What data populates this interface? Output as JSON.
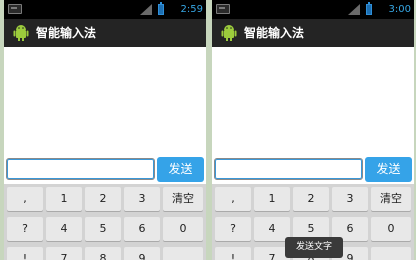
{
  "screens": [
    {
      "status_time": "2:59",
      "title": "智能输入法",
      "input_value": "",
      "send_label": "发送",
      "keys": [
        [
          ",",
          "1",
          "2",
          "3",
          "清空"
        ],
        [
          "?",
          "4",
          "5",
          "6",
          "0"
        ],
        [
          "!",
          "7",
          "8",
          "9",
          "."
        ]
      ],
      "toast": ""
    },
    {
      "status_time": "3:00",
      "title": "智能输入法",
      "input_value": "",
      "send_label": "发送",
      "keys": [
        [
          ",",
          "1",
          "2",
          "3",
          "清空"
        ],
        [
          "?",
          "4",
          "5",
          "6",
          "0"
        ],
        [
          "!",
          "7",
          "8",
          "9",
          "."
        ]
      ],
      "toast": "发送文字"
    }
  ],
  "colors": {
    "status_time": "#36a6e3",
    "send_button": "#35a3e8",
    "android_icon": "#9ccc3c"
  },
  "icons": [
    "android-app-icon",
    "signal-icon",
    "battery-icon",
    "notification-icon"
  ]
}
